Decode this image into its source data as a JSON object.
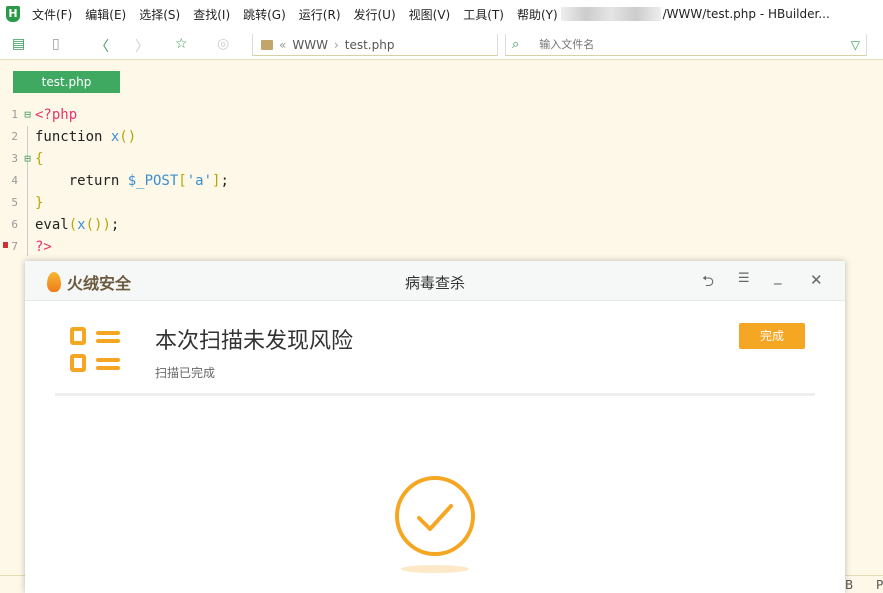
{
  "app": {
    "logo": "H",
    "title": "/WWW/test.php - HBuilder...",
    "minimize": "—"
  },
  "menu": [
    "文件(F)",
    "编辑(E)",
    "选择(S)",
    "查找(I)",
    "跳转(G)",
    "运行(R)",
    "发行(U)",
    "视图(V)",
    "工具(T)",
    "帮助(Y)"
  ],
  "toolbar": {
    "path_sep": "«",
    "path": [
      "WWW",
      "test.php"
    ],
    "search_placeholder": "输入文件名"
  },
  "tab": {
    "label": "test.php"
  },
  "code": {
    "line_numbers": [
      "1",
      "2",
      "3",
      "4",
      "5",
      "6",
      "7"
    ]
  },
  "status": {
    "right1": "B",
    "right2": "P"
  },
  "dialog": {
    "brand": "火绒安全",
    "title": "病毒查杀",
    "headline": "本次扫描未发现风险",
    "subtitle": "扫描已完成",
    "done_button": "完成",
    "accent": "#f5a623",
    "controls": {
      "back": "⮌",
      "menu": "☰",
      "minimize": "_",
      "close": "✕"
    }
  }
}
